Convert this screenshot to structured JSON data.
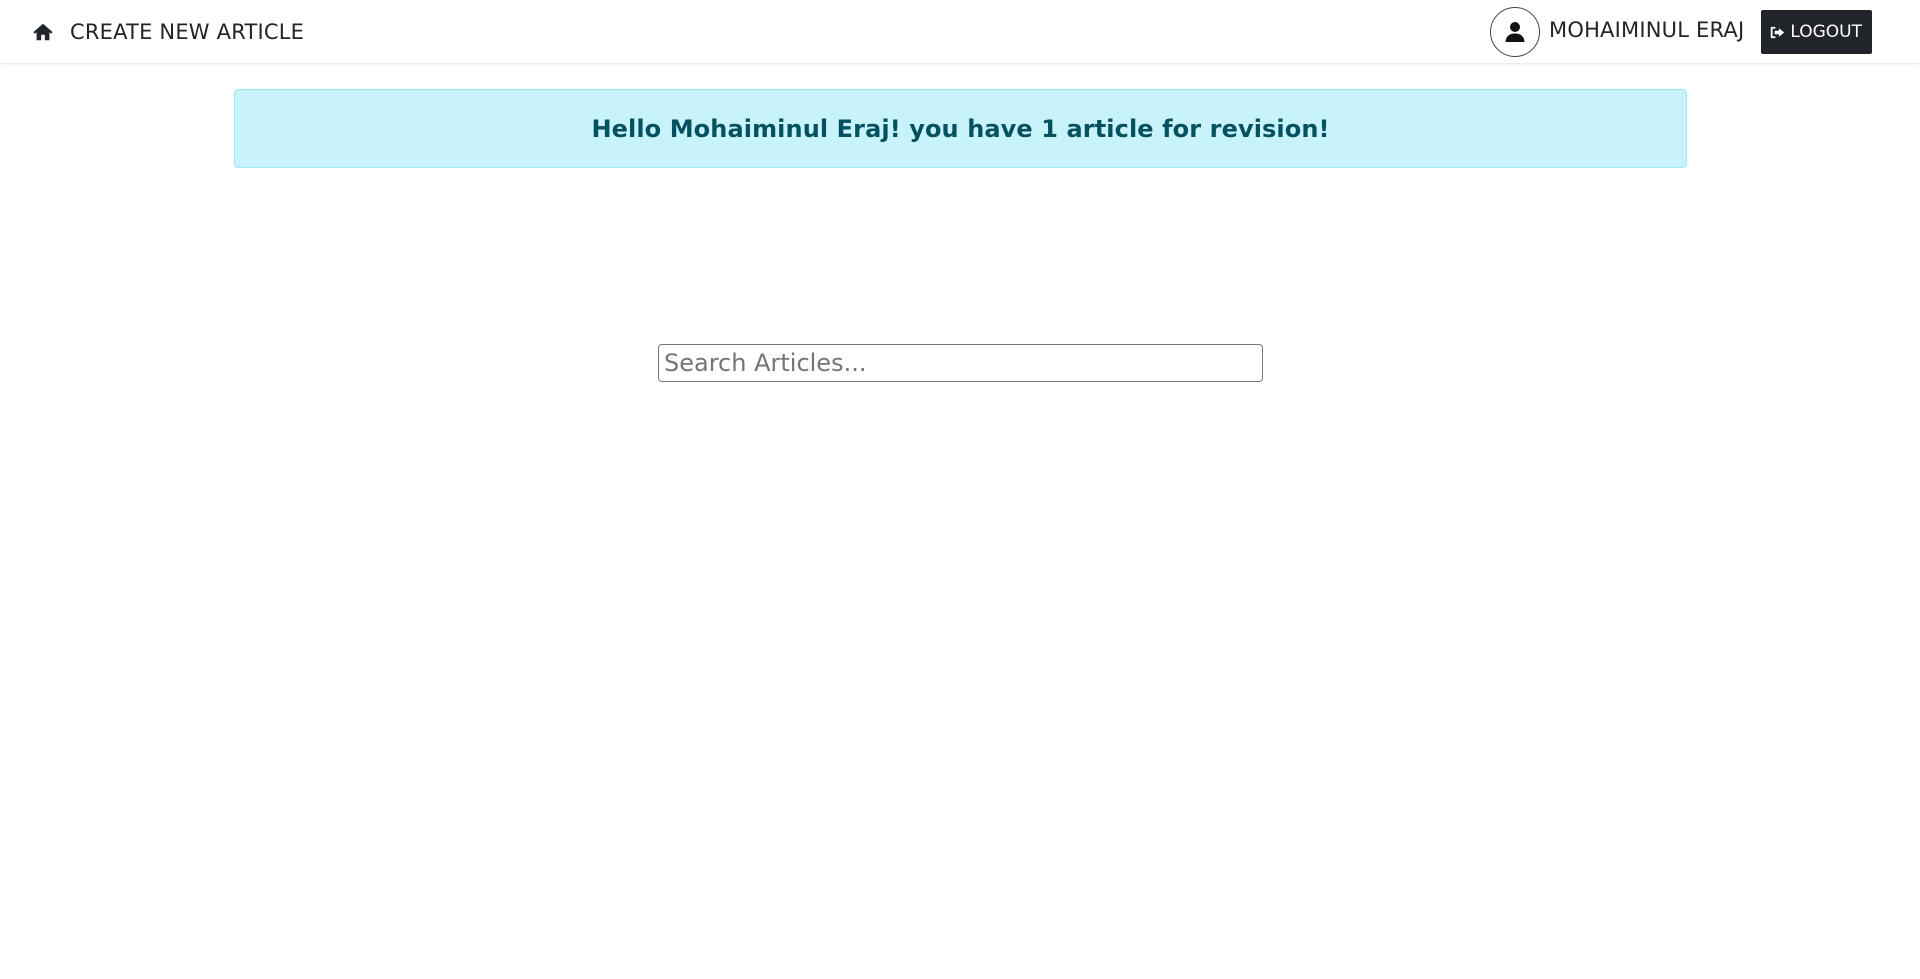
{
  "navbar": {
    "home_icon": "home-icon",
    "create_label": "CREATE NEW ARTICLE",
    "user": {
      "avatar_icon": "user-icon",
      "name": "MOHAIMINUL ERAJ"
    },
    "logout": {
      "icon": "sign-out-icon",
      "label": "LOGOUT"
    }
  },
  "alert": {
    "message": "Hello Mohaiminul Eraj! you have 1 article for revision!",
    "colors": {
      "background": "#c8f3fa",
      "border": "#9eeaf9",
      "text": "#055160"
    }
  },
  "search": {
    "value": "",
    "placeholder": "Search Articles..."
  },
  "colors": {
    "logout_button_bg": "#212529",
    "text": "#212529"
  }
}
